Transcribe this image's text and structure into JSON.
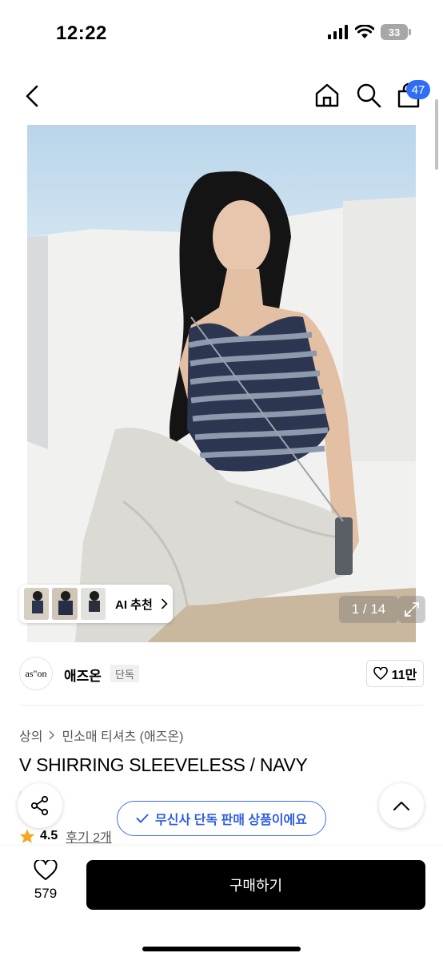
{
  "status": {
    "time": "12:22",
    "battery": "33"
  },
  "nav": {
    "cart_count": "47"
  },
  "gallery": {
    "counter": "1 / 14",
    "ai_label": "AI 추천"
  },
  "brand": {
    "logo_text": "as\"on",
    "name": "애즈온",
    "tag": "단독",
    "likes": "11만"
  },
  "breadcrumb": [
    "상의",
    "민소매 티셔츠 (애즈온)"
  ],
  "product": {
    "title": "V SHIRRING SLEEVELESS / NAVY",
    "exclusive_tag": "단독",
    "rating": "4.5",
    "reviews": "후기 2개"
  },
  "toast": "무신사 단독 판매 상품이에요",
  "bottom": {
    "wish_count": "579",
    "buy_label": "구매하기"
  },
  "colors": {
    "accent": "#2e6ef7",
    "toast": "#3c6ff0",
    "buy": "#000000",
    "star": "#f5a623"
  }
}
